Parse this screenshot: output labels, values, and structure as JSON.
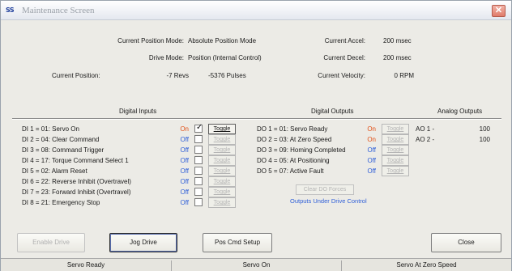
{
  "window": {
    "app_badge": "SS",
    "title": "Maintenance Screen",
    "close_glyph": "✕"
  },
  "position": {
    "mode_label": "Current Position Mode:",
    "mode_value": "Absolute Position Mode",
    "drive_label": "Drive Mode:",
    "drive_value": "Position (Internal Control)",
    "pos_label": "Current Position:",
    "revs": "-7 Revs",
    "pulses": "-5376 Pulses",
    "accel_label": "Current Accel:",
    "accel_value": "200 msec",
    "decel_label": "Current Decel:",
    "decel_value": "200 msec",
    "vel_label": "Current Velocity:",
    "vel_value": "0 RPM"
  },
  "headers": {
    "digital_inputs": "Digital Inputs",
    "digital_outputs": "Digital Outputs",
    "analog_outputs": "Analog Outputs"
  },
  "digital_inputs": [
    {
      "label": "DI 1 = 01: Servo On",
      "state": "On",
      "checked": true,
      "toggle": "Toggle",
      "enabled": true
    },
    {
      "label": "DI 2 = 04: Clear Command",
      "state": "Off",
      "checked": false,
      "toggle": "Toggle",
      "enabled": false
    },
    {
      "label": "DI 3 = 08: Command Trigger",
      "state": "Off",
      "checked": false,
      "toggle": "Toggle",
      "enabled": false
    },
    {
      "label": "DI 4 = 17: Torque Command Select 1",
      "state": "Off",
      "checked": false,
      "toggle": "Toggle",
      "enabled": false
    },
    {
      "label": "DI 5 = 02: Alarm Reset",
      "state": "Off",
      "checked": false,
      "toggle": "Toggle",
      "enabled": false
    },
    {
      "label": "DI 6 = 22: Reverse Inhibit (Overtravel)",
      "state": "Off",
      "checked": false,
      "toggle": "Toggle",
      "enabled": false
    },
    {
      "label": "DI 7 = 23: Forward Inhibit (Overtravel)",
      "state": "Off",
      "checked": false,
      "toggle": "Toggle",
      "enabled": false
    },
    {
      "label": "DI 8 = 21: Emergency Stop",
      "state": "Off",
      "checked": false,
      "toggle": "Toggle",
      "enabled": false
    }
  ],
  "digital_outputs": [
    {
      "label": "DO 1 = 01: Servo Ready",
      "state": "On",
      "toggle": "Toggle"
    },
    {
      "label": "DO 2 = 03: At Zero Speed",
      "state": "On",
      "toggle": "Toggle"
    },
    {
      "label": "DO 3 = 09: Homing Completed",
      "state": "Off",
      "toggle": "Toggle"
    },
    {
      "label": "DO 4 = 05: At Positioning",
      "state": "Off",
      "toggle": "Toggle"
    },
    {
      "label": "DO 5 = 07: Active Fault",
      "state": "Off",
      "toggle": "Toggle"
    }
  ],
  "clear_do": "Clear DO Forces",
  "outputs_note": "Outputs Under Drive Control",
  "analog_outputs": [
    {
      "label": "AO 1 -",
      "value": "100"
    },
    {
      "label": "AO 2 -",
      "value": "100"
    }
  ],
  "buttons": {
    "enable_drive": "Enable Drive",
    "jog_drive": "Jog Drive",
    "pos_cmd_setup": "Pos Cmd Setup",
    "close": "Close"
  },
  "status": [
    "Servo Ready",
    "Servo On",
    "Servo At Zero Speed"
  ],
  "colors": {
    "on": "#e2541c",
    "off": "#2f5fd8"
  }
}
